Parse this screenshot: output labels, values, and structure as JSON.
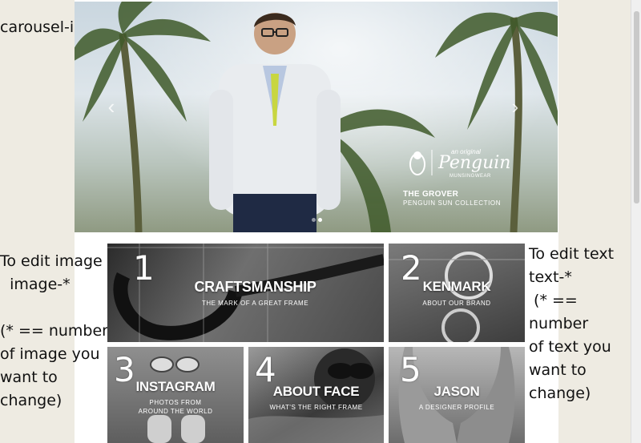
{
  "notes": {
    "carousel": "carousel-image",
    "image": "To edit image\n  image-*\n\n(* == number\nof image you\nwant to\nchange)",
    "text": "To edit text\ntext-*\n (* ==\nnumber\nof text you\nwant to\nchange)"
  },
  "carousel": {
    "prev_arrow": "‹",
    "next_arrow": "›",
    "brand_small": "an original",
    "brand_name": "Penguin",
    "brand_sub": "MUNSINGWEAR",
    "slide_title": "THE GROVER",
    "slide_subtitle": "PENGUIN SUN COLLECTION"
  },
  "tiles": [
    {
      "number": "1",
      "title": "CRAFTSMANSHIP",
      "subtitle": "THE MARK OF A GREAT FRAME"
    },
    {
      "number": "2",
      "title": "KENMARK",
      "subtitle": "ABOUT OUR BRAND"
    },
    {
      "number": "3",
      "title": "INSTAGRAM",
      "subtitle": "PHOTOS FROM\nAROUND THE WORLD"
    },
    {
      "number": "4",
      "title": "ABOUT FACE",
      "subtitle": "WHAT'S THE RIGHT FRAME"
    },
    {
      "number": "5",
      "title": "JASON",
      "subtitle": "A DESIGNER PROFILE"
    }
  ]
}
